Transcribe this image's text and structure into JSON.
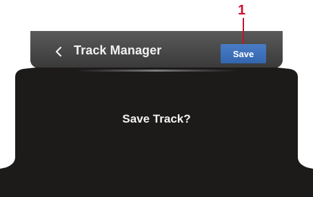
{
  "header": {
    "title": "Track Manager",
    "save_label": "Save"
  },
  "dialog": {
    "message": "Save Track?"
  },
  "callout": {
    "number": "1"
  },
  "colors": {
    "screen_background": "#1d1a1a",
    "header_background": "#4a4a4a",
    "save_button": "#3d70bb",
    "callout": "#c8102e"
  },
  "icons": {
    "back": "chevron-left-icon"
  }
}
